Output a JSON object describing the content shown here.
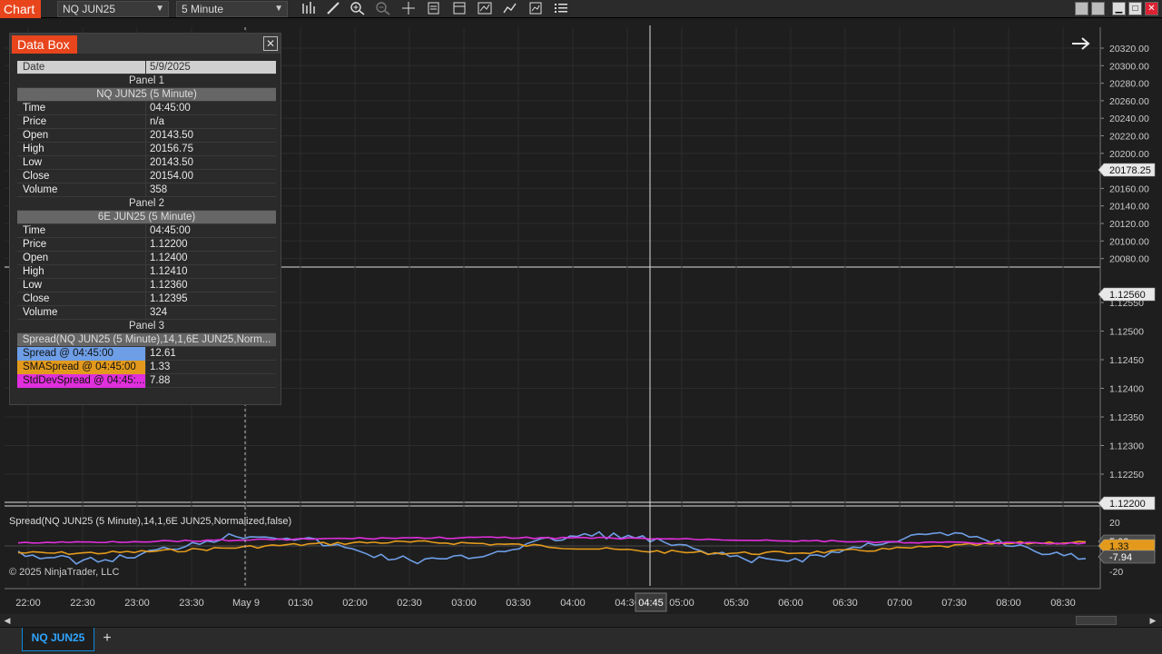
{
  "app": {
    "title": "Chart"
  },
  "toolbar": {
    "instrument": "NQ JUN25",
    "interval": "5 Minute",
    "icons": [
      "bar-style-icon",
      "draw-tool-icon",
      "zoom-in-icon",
      "zoom-out-icon",
      "crosshair-icon",
      "properties-icon",
      "templates-icon",
      "strategies-icon",
      "indicators-icon",
      "data-series-icon",
      "more-icon"
    ]
  },
  "window": {
    "buttons": [
      "restore-icon",
      "maximize-alt-icon",
      "minimize-icon",
      "maximize-icon",
      "close-icon"
    ]
  },
  "databox": {
    "title": "Data Box",
    "close": "✕",
    "date_label": "Date",
    "date_value": "5/9/2025",
    "panel1": "Panel 1",
    "panel1_instrument": "NQ JUN25 (5 Minute)",
    "p1": [
      [
        "Time",
        "04:45:00"
      ],
      [
        "Price",
        "n/a"
      ],
      [
        "Open",
        "20143.50"
      ],
      [
        "High",
        "20156.75"
      ],
      [
        "Low",
        "20143.50"
      ],
      [
        "Close",
        "20154.00"
      ],
      [
        "Volume",
        "358"
      ]
    ],
    "panel2": "Panel 2",
    "panel2_instrument": "6E JUN25 (5 Minute)",
    "p2": [
      [
        "Time",
        "04:45:00"
      ],
      [
        "Price",
        "1.12200"
      ],
      [
        "Open",
        "1.12400"
      ],
      [
        "High",
        "1.12410"
      ],
      [
        "Low",
        "1.12360"
      ],
      [
        "Close",
        "1.12395"
      ],
      [
        "Volume",
        "324"
      ]
    ],
    "panel3": "Panel 3",
    "panel3_indicator": "Spread(NQ JUN25 (5 Minute),14,1,6E JUN25,Norm...",
    "p3": [
      [
        "Spread @ 04:45:00",
        "12.61"
      ],
      [
        "SMASpread @ 04:45:00",
        "1.33"
      ],
      [
        "StdDevSpread @ 04:45:...",
        "7.88"
      ]
    ]
  },
  "panels": {
    "price1": {
      "axis_labels": [
        "20320.00",
        "20300.00",
        "20280.00",
        "20260.00",
        "20240.00",
        "20220.00",
        "20200.00",
        "20180.00",
        "20160.00",
        "20140.00",
        "20120.00",
        "20100.00",
        "20080.00"
      ],
      "last_price": "20178.25"
    },
    "price2": {
      "axis_labels": [
        "1.12550",
        "1.12500",
        "1.12450",
        "1.12400",
        "1.12350",
        "1.12300",
        "1.12250"
      ],
      "last_price": "1.12560",
      "bottom_marker": "1.12200"
    },
    "indicator": {
      "label": "Spread(NQ JUN25 (5 Minute),14,1,6E JUN25,Normalized,false)",
      "axis_labels": [
        "20",
        "-20"
      ],
      "markers": [
        {
          "text": "5.03",
          "color": "#4a4a4a"
        },
        {
          "text": "1.33",
          "color": "#e39a1c"
        },
        {
          "text": "-7.94",
          "color": "#4a4a4a"
        }
      ]
    }
  },
  "copyright": "© 2025 NinjaTrader, LLC",
  "time_axis": {
    "labels": [
      "22:00",
      "22:30",
      "23:00",
      "23:30",
      "May 9",
      "01:30",
      "02:00",
      "02:30",
      "03:00",
      "03:30",
      "04:00",
      "04:30",
      "05:00",
      "05:30",
      "06:00",
      "06:30",
      "07:00",
      "07:30",
      "08:00",
      "08:30"
    ],
    "cursor": "04:45"
  },
  "colors": {
    "up": "#3fd04a",
    "down": "#e8222d",
    "spread": "#6e9ee6",
    "sma": "#e39a1c",
    "stddev": "#e02fdc",
    "accent": "#e8451c"
  },
  "tabs": [
    {
      "label": "NQ JUN25"
    }
  ],
  "tab_add": "+"
}
